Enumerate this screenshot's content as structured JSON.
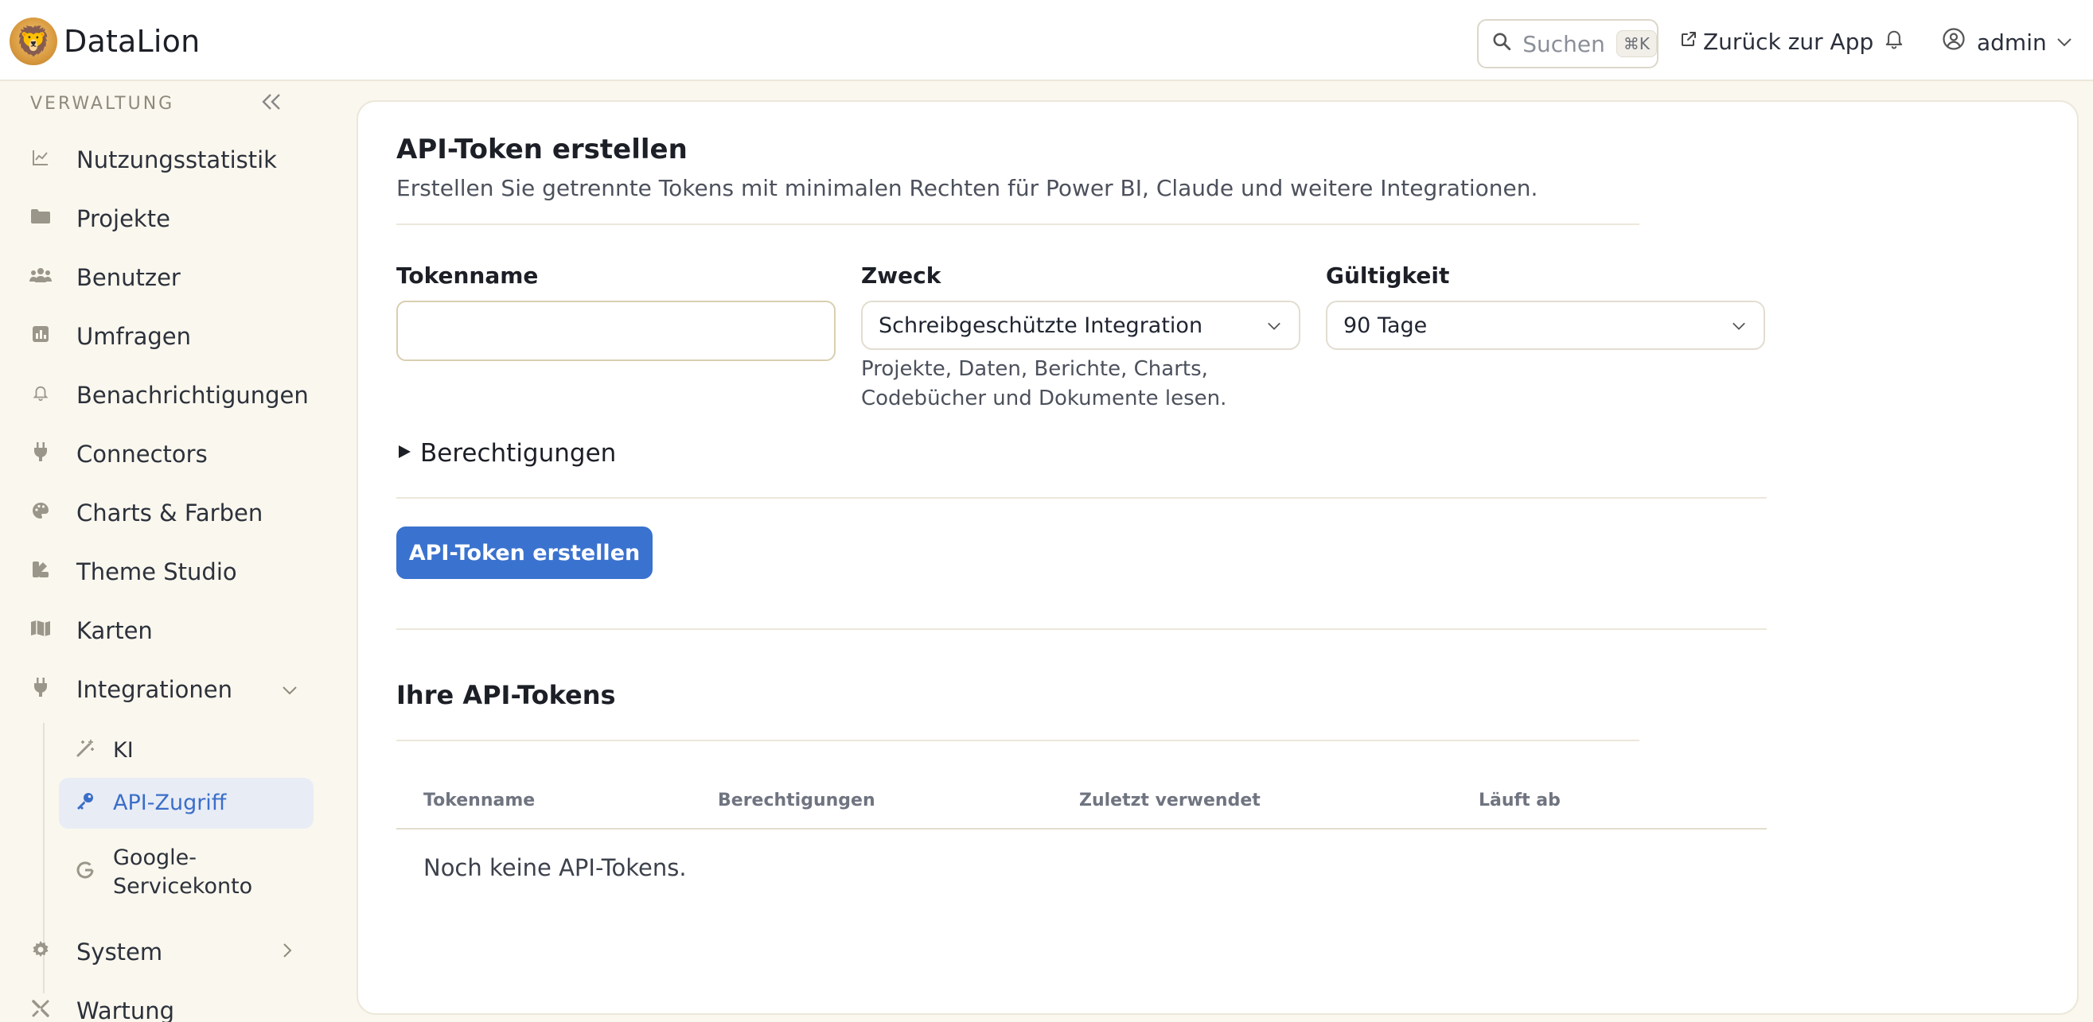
{
  "header": {
    "brand": "DataLion",
    "search": {
      "label": "Suchen",
      "shortcut": "⌘K"
    },
    "back_to_app": "Zurück zur App",
    "user": "admin"
  },
  "sidebar": {
    "section_title": "VERWALTUNG",
    "items": [
      {
        "label": "Nutzungsstatistik",
        "icon": "chart-line-icon"
      },
      {
        "label": "Projekte",
        "icon": "folder-icon"
      },
      {
        "label": "Benutzer",
        "icon": "users-icon"
      },
      {
        "label": "Umfragen",
        "icon": "poll-icon"
      },
      {
        "label": "Benachrichtigungen",
        "icon": "bell-icon"
      },
      {
        "label": "Connectors",
        "icon": "plug-icon"
      },
      {
        "label": "Charts & Farben",
        "icon": "palette-icon"
      },
      {
        "label": "Theme Studio",
        "icon": "theme-icon"
      },
      {
        "label": "Karten",
        "icon": "map-icon"
      },
      {
        "label": "Integrationen",
        "icon": "plug-icon"
      }
    ],
    "sub_items": [
      {
        "label": "KI",
        "icon": "magic-wand-icon"
      },
      {
        "label": "API-Zugriff",
        "icon": "key-icon",
        "active": true
      },
      {
        "label_line1": "Google-",
        "label_line2": "Servicekonto",
        "icon": "google-icon"
      }
    ],
    "bottom_items": [
      {
        "label": "System",
        "icon": "gear-icon"
      },
      {
        "label": "Wartung",
        "icon": "tools-icon"
      }
    ]
  },
  "create": {
    "title": "API-Token erstellen",
    "description": "Erstellen Sie getrennte Tokens mit minimalen Rechten für Power BI, Claude und weitere Integrationen.",
    "token_name_label": "Tokenname",
    "token_name_value": "",
    "purpose_label": "Zweck",
    "purpose_value": "Schreibgeschützte Integration",
    "purpose_help": "Projekte, Daten, Berichte, Charts, Codebücher und Dokumente lesen.",
    "validity_label": "Gültigkeit",
    "validity_value": "90 Tage",
    "permissions_toggle": "Berechtigungen",
    "submit": "API-Token erstellen"
  },
  "tokens": {
    "title": "Ihre API-Tokens",
    "columns": [
      "Tokenname",
      "Berechtigungen",
      "Zuletzt verwendet",
      "Läuft ab"
    ],
    "empty": "Noch keine API-Tokens."
  },
  "colors": {
    "accent": "#3a72cf",
    "background": "#faf7ee",
    "active_nav_bg": "#e8ecf5"
  }
}
